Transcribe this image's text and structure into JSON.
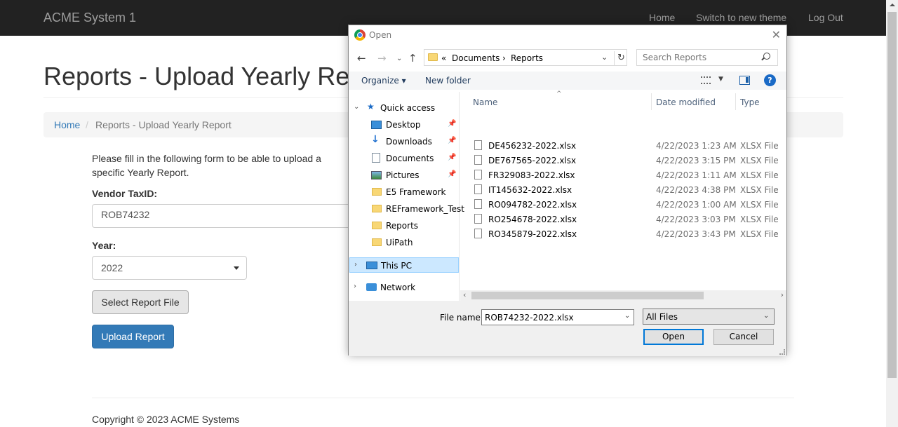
{
  "page": {
    "brand": "ACME System 1",
    "nav": {
      "home": "Home",
      "theme": "Switch to new theme",
      "logout": "Log Out"
    },
    "title": "Reports - Upload Yearly Report",
    "breadcrumb": {
      "home": "Home",
      "separator": "/",
      "current": "Reports - Upload Yearly Report"
    },
    "intro": "Please fill in the following form to be able to upload a specific Yearly Report.",
    "vendor_label": "Vendor TaxID:",
    "vendor_value": "ROB74232",
    "year_label": "Year:",
    "year_value": "2022",
    "select_file_button": "Select Report File",
    "upload_button": "Upload Report",
    "footer": "Copyright © 2023 ACME Systems"
  },
  "dialog": {
    "title": "Open",
    "path_prefix": "«",
    "path": [
      "Documents",
      "Reports"
    ],
    "path_separator": "›",
    "search_placeholder": "Search Reports",
    "toolbar": {
      "organize": "Organize ▾",
      "new_folder": "New folder",
      "help": "?"
    },
    "tree": [
      {
        "label": "Quick access",
        "icon": "star-icon",
        "pinned": false
      },
      {
        "label": "Desktop",
        "icon": "desktop-icon",
        "pinned": true
      },
      {
        "label": "Downloads",
        "icon": "download-icon",
        "pinned": true
      },
      {
        "label": "Documents",
        "icon": "document-icon",
        "pinned": true
      },
      {
        "label": "Pictures",
        "icon": "pictures-icon",
        "pinned": true
      },
      {
        "label": "E5 Framework",
        "icon": "folder-icon",
        "pinned": false
      },
      {
        "label": "REFramework_Test",
        "icon": "folder-icon",
        "pinned": false
      },
      {
        "label": "Reports",
        "icon": "folder-icon",
        "pinned": false
      },
      {
        "label": "UiPath",
        "icon": "folder-icon",
        "pinned": false
      },
      {
        "label": "This PC",
        "icon": "computer-icon",
        "pinned": false
      },
      {
        "label": "Network",
        "icon": "network-icon",
        "pinned": false
      }
    ],
    "columns": {
      "name": "Name",
      "date": "Date modified",
      "type": "Type"
    },
    "files": [
      {
        "name": "DE456232-2022.xlsx",
        "date": "4/22/2023 1:23 AM",
        "type": "XLSX File"
      },
      {
        "name": "DE767565-2022.xlsx",
        "date": "4/22/2023 3:15 PM",
        "type": "XLSX File"
      },
      {
        "name": "FR329083-2022.xlsx",
        "date": "4/22/2023 1:11 AM",
        "type": "XLSX File"
      },
      {
        "name": "IT145632-2022.xlsx",
        "date": "4/22/2023 4:38 PM",
        "type": "XLSX File"
      },
      {
        "name": "RO094782-2022.xlsx",
        "date": "4/22/2023 1:00 AM",
        "type": "XLSX File"
      },
      {
        "name": "RO254678-2022.xlsx",
        "date": "4/22/2023 3:03 PM",
        "type": "XLSX File"
      },
      {
        "name": "RO345879-2022.xlsx",
        "date": "4/22/2023 3:43 PM",
        "type": "XLSX File"
      }
    ],
    "file_name_label": "File name:",
    "file_name_value": "ROB74232-2022.xlsx",
    "file_type": "All Files",
    "open_button": "Open",
    "cancel_button": "Cancel"
  }
}
